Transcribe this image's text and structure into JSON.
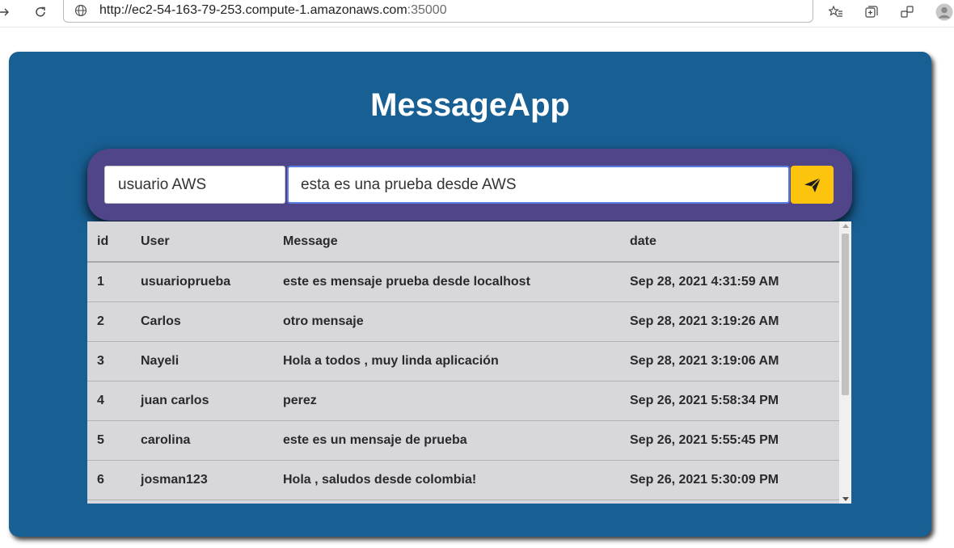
{
  "browser": {
    "url_host": "http://ec2-54-163-79-253.compute-1.amazonaws.com",
    "url_port": ":35000"
  },
  "app": {
    "title": "MessageApp",
    "accent_bg": "#185f93",
    "composer_bg": "#51458a",
    "send_color": "#fcc40c"
  },
  "composer": {
    "user_value": "usuario AWS",
    "message_value": "esta es una prueba desde AWS",
    "send_icon": "paper-plane-icon"
  },
  "table": {
    "headers": [
      "id",
      "User",
      "Message",
      "date"
    ],
    "rows": [
      {
        "id": "1",
        "user": "usuarioprueba",
        "message": "este es mensaje prueba desde localhost",
        "date": "Sep 28, 2021 4:31:59 AM"
      },
      {
        "id": "2",
        "user": "Carlos",
        "message": "otro mensaje",
        "date": "Sep 28, 2021 3:19:26 AM"
      },
      {
        "id": "3",
        "user": "Nayeli",
        "message": "Hola a todos , muy linda aplicación",
        "date": "Sep 28, 2021 3:19:06 AM"
      },
      {
        "id": "4",
        "user": "juan carlos",
        "message": "perez",
        "date": "Sep 26, 2021 5:58:34 PM"
      },
      {
        "id": "5",
        "user": "carolina",
        "message": "este es un mensaje de prueba",
        "date": "Sep 26, 2021 5:55:45 PM"
      },
      {
        "id": "6",
        "user": "josman123",
        "message": "Hola , saludos desde colombia!",
        "date": "Sep 26, 2021 5:30:09 PM"
      },
      {
        "id": "",
        "user": "",
        "message": "",
        "date": ""
      }
    ]
  }
}
